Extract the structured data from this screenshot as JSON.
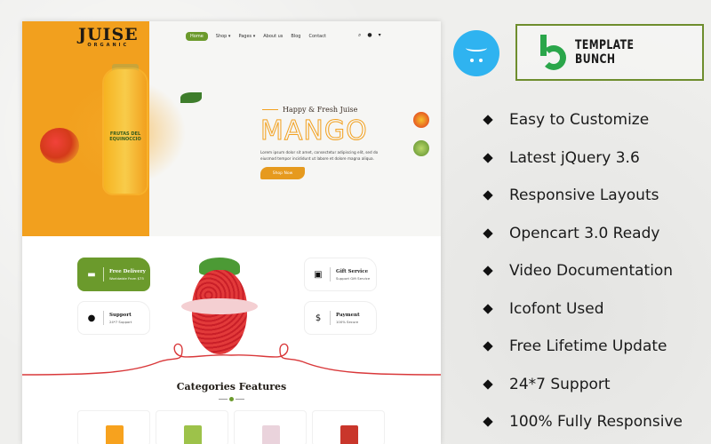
{
  "preview": {
    "logo": {
      "title": "JUISE",
      "subtitle": "ORGANIC"
    },
    "nav": {
      "items": [
        {
          "label": "Home",
          "active": true
        },
        {
          "label": "Shop ▾",
          "active": false
        },
        {
          "label": "Pages ▾",
          "active": false
        },
        {
          "label": "About us",
          "active": false
        },
        {
          "label": "Blog",
          "active": false
        },
        {
          "label": "Contact",
          "active": false
        }
      ],
      "icons": [
        "search-icon",
        "user-icon",
        "cart-icon"
      ]
    },
    "hero": {
      "tagline": "Happy & Fresh Juise",
      "title": "MANGO",
      "description": "Lorem ipsum dolor sit amet, consectetur adipiscing elit, sed do eiusmod tempor incididunt ut labore et dolore magna aliqua.",
      "button": "Shop Now",
      "bottle_label": "FRUTAS DEL EQUINOCCIO"
    },
    "services": [
      {
        "title": "Free Delivery",
        "subtitle": "Worldwide From $75",
        "icon": "truck-icon",
        "highlight": true
      },
      {
        "title": "Gift Service",
        "subtitle": "Support Gift Service",
        "icon": "gift-icon",
        "highlight": false
      },
      {
        "title": "Support",
        "subtitle": "24*7 Support",
        "icon": "headset-icon",
        "highlight": false
      },
      {
        "title": "Payment",
        "subtitle": "100% Secure",
        "icon": "money-bag-icon",
        "highlight": false
      }
    ],
    "categories": {
      "title": "Categories Features",
      "items": [
        {
          "name": "orange-juice",
          "color": "#f7a21e"
        },
        {
          "name": "green-juice",
          "color": "#9dc24a"
        },
        {
          "name": "strawberry-shake",
          "color": "#ead3dc"
        },
        {
          "name": "tomato-juice",
          "color": "#c9362b"
        }
      ]
    }
  },
  "brand": {
    "name": "TEMPLATE BUNCH"
  },
  "features": [
    "Easy to Customize",
    "Latest jQuery 3.6",
    "Responsive Layouts",
    "Opencart 3.0 Ready",
    "Video Documentation",
    "Icofont Used",
    "Free Lifetime Update",
    "24*7 Support",
    "100% Fully Responsive"
  ],
  "colors": {
    "orange": "#f2a01e",
    "green": "#6b9a2c",
    "opencart_blue": "#2fb3f0",
    "brand_green": "#2aa64a"
  }
}
